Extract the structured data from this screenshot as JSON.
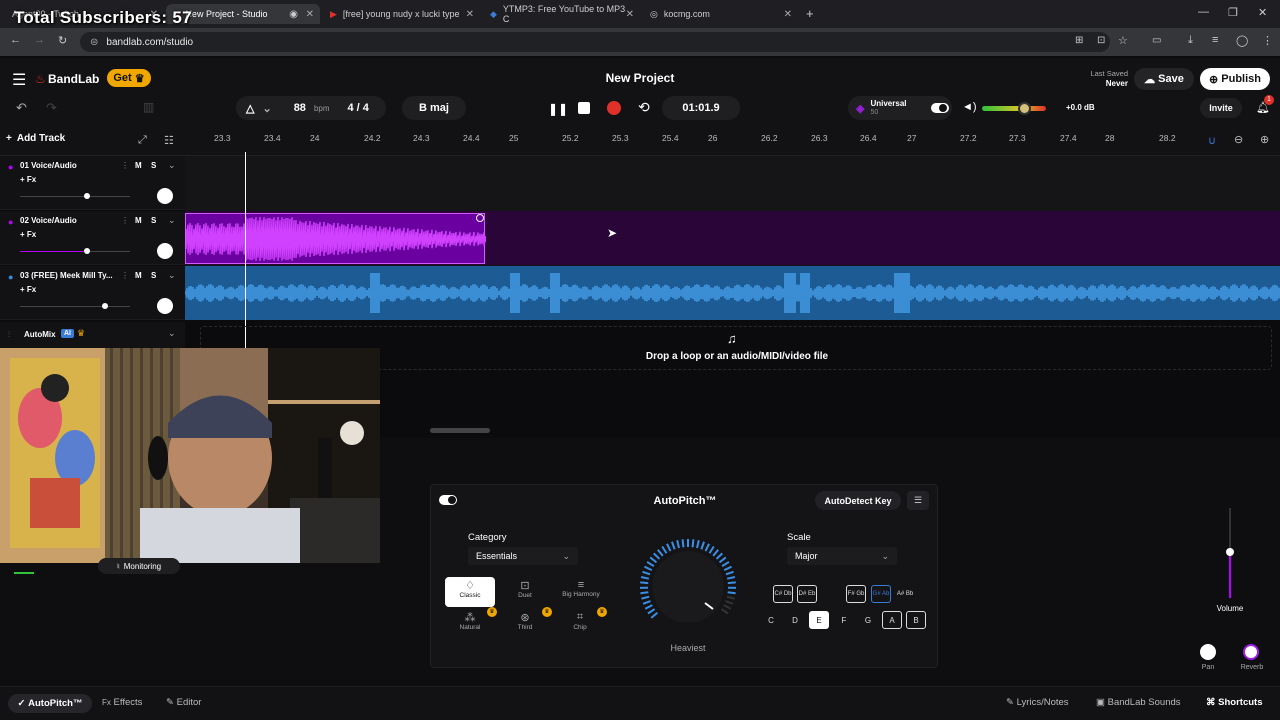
{
  "overlay": {
    "subscribers": "Total Subscribers: 57"
  },
  "browser": {
    "tabs": [
      {
        "label": "Agent00 - Twitch",
        "active": false
      },
      {
        "label": "New Project - Studio",
        "active": true
      },
      {
        "label": "[free] young nudy x lucki type",
        "active": false
      },
      {
        "label": "YTMP3: Free YouTube to MP3 C",
        "active": false
      },
      {
        "label": "kocmg.com",
        "active": false
      }
    ],
    "url": "bandlab.com/studio"
  },
  "header": {
    "brand": "BandLab",
    "get_label": "Get",
    "project_title": "New Project",
    "last_saved_label": "Last Saved",
    "last_saved_value": "Never",
    "save_label": "Save",
    "publish_label": "Publish",
    "bpm": "88",
    "bpm_unit": "bpm",
    "time_sig": "4 / 4",
    "key": "B maj",
    "time": "01:01.9",
    "universal_label": "Universal",
    "universal_value": "50",
    "db": "+0.0 dB",
    "invite_label": "Invite",
    "notif_count": "1"
  },
  "timeline": {
    "add_track_label": "Add Track",
    "ticks": [
      "23.3",
      "23.4",
      "24",
      "24.2",
      "24.3",
      "24.4",
      "25",
      "25.2",
      "25.3",
      "25.4",
      "26",
      "26.2",
      "26.3",
      "26.4",
      "27",
      "27.2",
      "27.3",
      "27.4",
      "28",
      "28.2"
    ]
  },
  "tracks": [
    {
      "name": "01  Voice/Audio",
      "fx": "+ Fx",
      "m": "M",
      "s": "S",
      "volume": 0.8
    },
    {
      "name": "02  Voice/Audio",
      "fx": "+ Fx",
      "m": "M",
      "s": "S",
      "volume": 0.8
    },
    {
      "name": "03  (FREE) Meek Mill Ty...",
      "fx": "+ Fx",
      "m": "M",
      "s": "S",
      "volume": 0.95
    }
  ],
  "automix": {
    "label": "AutoMix",
    "badge": "AI"
  },
  "drop_zone": {
    "text": "Drop a loop or an audio/MIDI/video file"
  },
  "monitoring": {
    "label": "Monitoring"
  },
  "autopitch": {
    "title": "AutoPitch™",
    "autodetect_label": "AutoDetect Key",
    "category_label": "Category",
    "category_value": "Essentials",
    "scale_label": "Scale",
    "scale_value": "Major",
    "knob_label": "Heaviest",
    "modes": [
      "Classic",
      "Duet",
      "Big Harmony",
      "Natural",
      "Third",
      "Chip"
    ],
    "top_keys": [
      "C# Db",
      "D# Eb",
      "F# Gb",
      "G# Ab",
      "A# Bb"
    ],
    "bottom_keys": [
      "C",
      "D",
      "E",
      "F",
      "G",
      "A",
      "B"
    ]
  },
  "mixer": {
    "volume_label": "Volume",
    "pan_label": "Pan",
    "reverb_label": "Reverb"
  },
  "footer": {
    "autopitch_tab": "AutoPitch™",
    "effects_tab": "Effects",
    "editor_tab": "Editor",
    "lyrics_label": "Lyrics/Notes",
    "sounds_label": "BandLab Sounds",
    "shortcuts_label": "Shortcuts"
  },
  "colors": {
    "accent": "#9a1fe0",
    "purple": "#b700ff",
    "blue": "#2f8fe0",
    "red": "#e0302a"
  }
}
